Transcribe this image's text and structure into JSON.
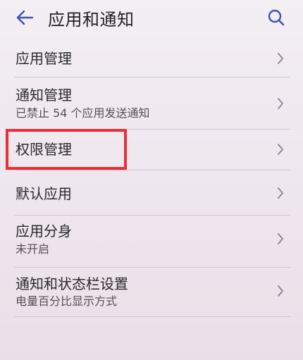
{
  "header": {
    "title": "应用和通知",
    "back_icon": "back-arrow-icon",
    "search_icon": "search-icon",
    "accent": "#3f51b5"
  },
  "items": [
    {
      "label": "应用管理",
      "sub": ""
    },
    {
      "label": "通知管理",
      "sub": "已禁止 54 个应用发送通知"
    },
    {
      "label": "权限管理",
      "sub": ""
    },
    {
      "label": "默认应用",
      "sub": ""
    },
    {
      "label": "应用分身",
      "sub": "未开启"
    },
    {
      "label": "通知和状态栏设置",
      "sub": "电量百分比显示方式"
    }
  ],
  "annotation": {
    "highlight_color": "#ea2e36",
    "highlighted_item": "权限管理"
  }
}
